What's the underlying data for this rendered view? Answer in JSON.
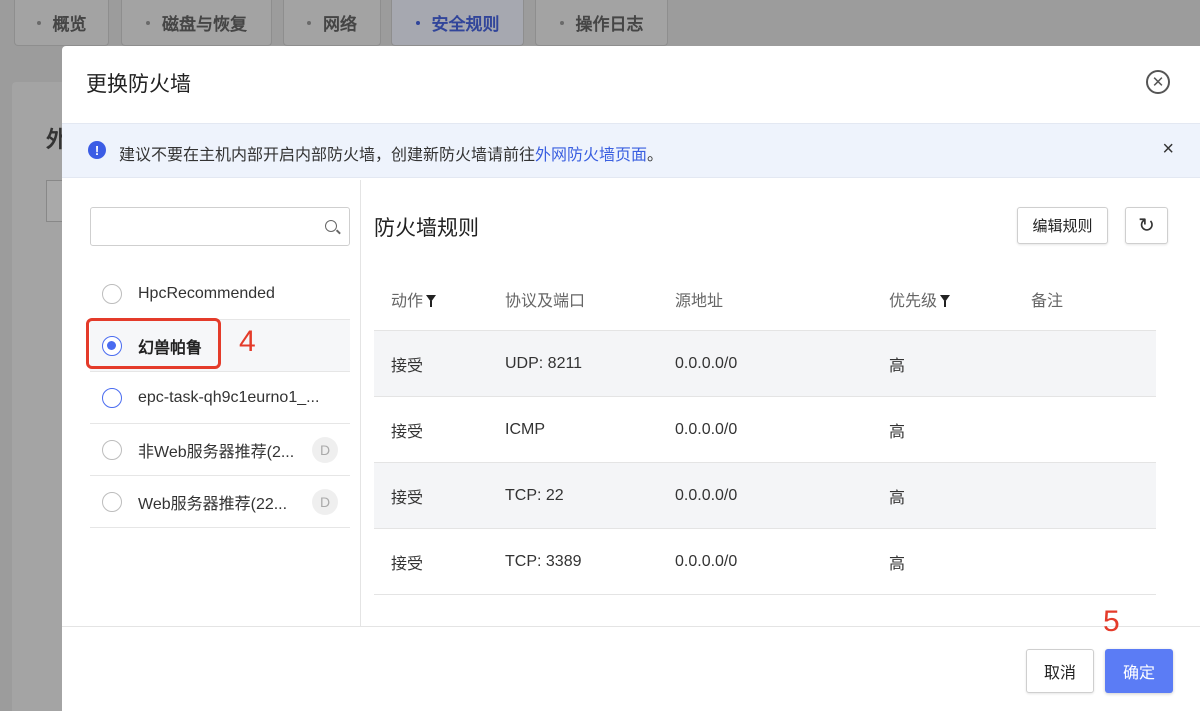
{
  "background": {
    "tabs": [
      {
        "label": "概览",
        "active": false
      },
      {
        "label": "磁盘与恢复",
        "active": false
      },
      {
        "label": "网络",
        "active": false
      },
      {
        "label": "安全规则",
        "active": true
      },
      {
        "label": "操作日志",
        "active": false
      }
    ],
    "section_char": "外"
  },
  "modal": {
    "title": "更换防火墙",
    "notice": {
      "text": "建议不要在主机内部开启内部防火墙，创建新防火墙请前往",
      "link": "外网防火墙页面",
      "suffix": "。"
    },
    "search": {
      "value": "",
      "placeholder": ""
    },
    "firewalls": [
      {
        "name": "HpcRecommended",
        "selected": false,
        "badge": ""
      },
      {
        "name": "幻兽帕鲁",
        "selected": true,
        "badge": ""
      },
      {
        "name": "epc-task-qh9c1eurno1_...",
        "selected": false,
        "badge": ""
      },
      {
        "name": "非Web服务器推荐(2...",
        "selected": false,
        "badge": "D"
      },
      {
        "name": "Web服务器推荐(22...",
        "selected": false,
        "badge": "D"
      }
    ],
    "rules_title": "防火墙规则",
    "edit_rules_label": "编辑规则",
    "columns": {
      "action": "动作",
      "protocol": "协议及端口",
      "source": "源地址",
      "priority": "优先级",
      "remark": "备注"
    },
    "rules": [
      {
        "action": "接受",
        "protocol": "UDP: 8211",
        "source": "0.0.0.0/0",
        "priority": "高",
        "remark": ""
      },
      {
        "action": "接受",
        "protocol": "ICMP",
        "source": "0.0.0.0/0",
        "priority": "高",
        "remark": ""
      },
      {
        "action": "接受",
        "protocol": "TCP: 22",
        "source": "0.0.0.0/0",
        "priority": "高",
        "remark": ""
      },
      {
        "action": "接受",
        "protocol": "TCP: 3389",
        "source": "0.0.0.0/0",
        "priority": "高",
        "remark": ""
      }
    ],
    "cancel_label": "取消",
    "confirm_label": "确定"
  },
  "annotations": {
    "step_4": "4",
    "step_5": "5",
    "color": "#e43b2a"
  }
}
